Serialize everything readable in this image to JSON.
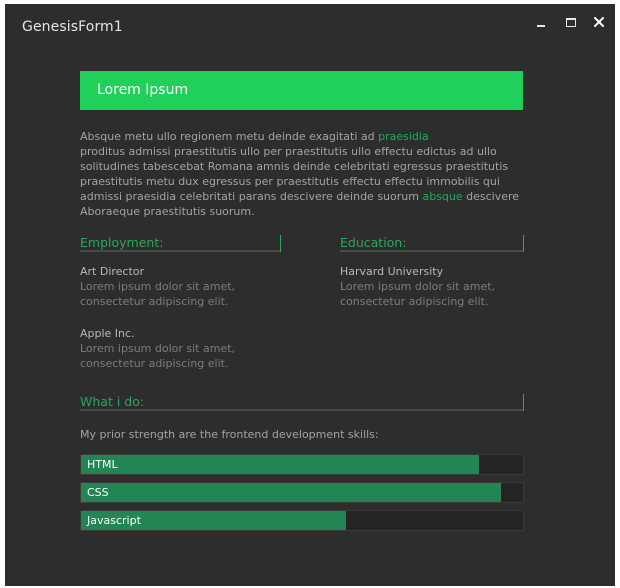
{
  "window": {
    "title": "GenesisForm1",
    "controls": {
      "minimize": "minimize-icon",
      "maximize": "maximize-icon",
      "close": "close-icon"
    }
  },
  "header": {
    "title": "Lorem Ipsum"
  },
  "intro": {
    "seg1": "Absque metu ullo regionem metu deinde exagitati ad",
    "hl1": "praesidia",
    "seg2": "proditus admissi praestitutis ullo per praestitutis ullo effectu edictus ad ullo solitudines tabescebat Romana amnis deinde celebritati egressus praestitutis praestitutis metu dux egressus per praestitutis effectu effectu immobilis qui admissi praesidia celebritati parans descivere deinde suorum",
    "hl2": "absque",
    "seg3": "descivere Aboraeque praestitutis suorum."
  },
  "employment": {
    "heading": "Employment:",
    "items": [
      {
        "title": "Art Director",
        "line1": "Lorem ipsum dolor sit amet,",
        "line2": "consectetur adipiscing elit."
      },
      {
        "title": "Apple Inc.",
        "line1": "Lorem ipsum dolor sit amet,",
        "line2": "consectetur adipiscing elit."
      }
    ]
  },
  "education": {
    "heading": "Education:",
    "items": [
      {
        "title": "Harvard University",
        "line1": "Lorem ipsum dolor sit amet,",
        "line2": "consectetur adipiscing elit."
      }
    ]
  },
  "skills": {
    "heading": "What i do:",
    "intro": "My prior strength are the frontend development skills:",
    "items": [
      {
        "label": "HTML",
        "level": 0.9
      },
      {
        "label": "CSS",
        "level": 0.95
      },
      {
        "label": "Javascript",
        "level": 0.6
      }
    ]
  },
  "colors": {
    "background": "#2d2d2d",
    "accent": "#21d05b",
    "accent_text": "#27a85a",
    "bar_fill": "#228654",
    "bar_track": "#242424"
  }
}
